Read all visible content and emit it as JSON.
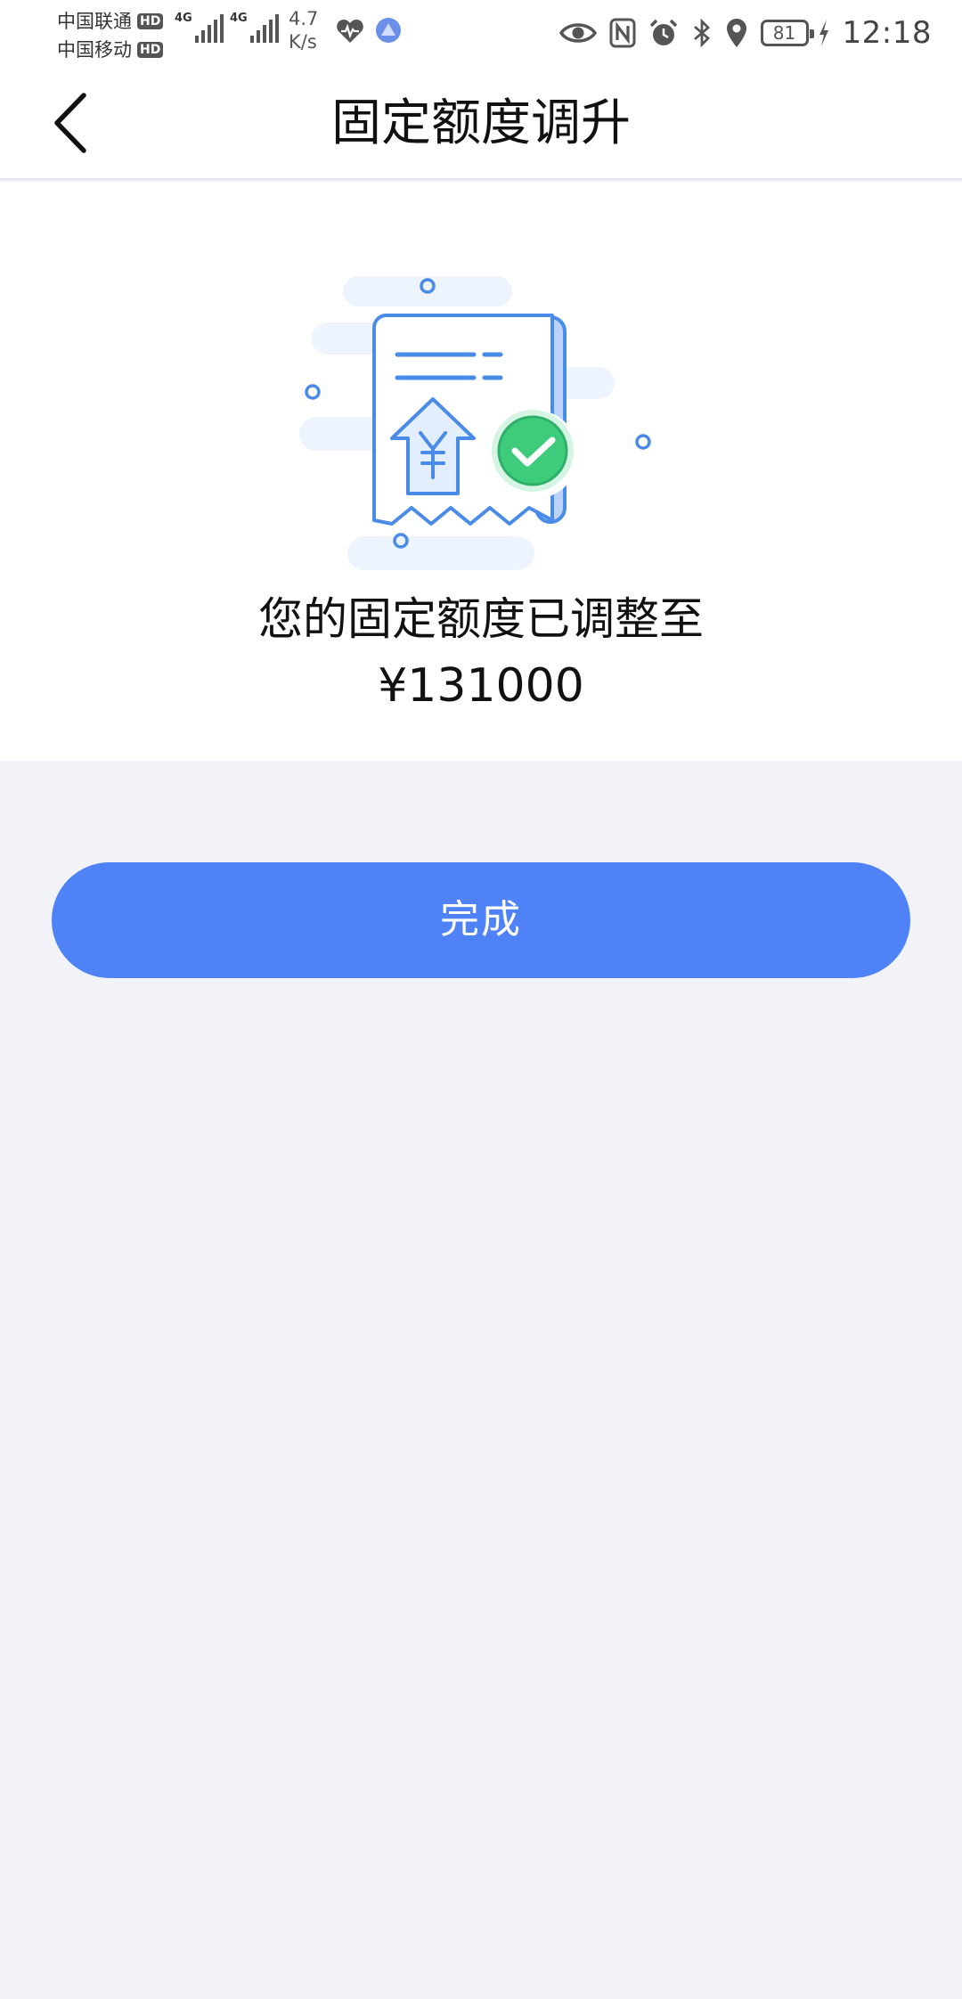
{
  "status_bar": {
    "carrier_1": "中国联通",
    "carrier_2": "中国移动",
    "hd_label": "HD",
    "sim1_tech": "4G",
    "sim2_tech": "4G",
    "net_speed_value": "4.7",
    "net_speed_unit": "K/s",
    "battery_level": "81",
    "time": "12:18",
    "icons": [
      "heart-rate-icon",
      "app-notification-icon",
      "eye-comfort-icon",
      "nfc-icon",
      "alarm-icon",
      "bluetooth-icon",
      "location-icon",
      "battery-icon",
      "charging-icon"
    ]
  },
  "nav": {
    "back_icon": "chevron-left-icon",
    "title": "固定额度调升"
  },
  "result": {
    "illustration_icon": "receipt-success-icon",
    "message": "您的固定额度已调整至",
    "amount": "¥131000"
  },
  "actions": {
    "done_label": "完成"
  },
  "colors": {
    "primary": "#4f82f7",
    "success": "#3ecb7c",
    "page_background": "#f1f3f8",
    "card_background": "#ffffff"
  }
}
